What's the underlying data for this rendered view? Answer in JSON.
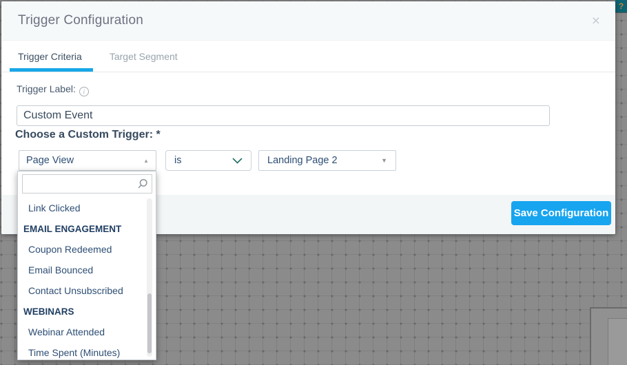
{
  "window": {
    "help_badge": "?"
  },
  "modal": {
    "title": "Trigger Configuration",
    "close": "×",
    "tabs": [
      {
        "label": "Trigger Criteria"
      },
      {
        "label": "Target Segment"
      }
    ],
    "fields": {
      "trigger_label": "Trigger Label:",
      "trigger_label_value": "Custom Event",
      "custom_trigger_label": "Choose a Custom Trigger: *"
    },
    "selects": {
      "trigger_type": "Page View",
      "operator": "is",
      "target": "Landing Page 2",
      "caret_up": "▲",
      "caret_down": "▼"
    },
    "dropdown": {
      "search_value": "",
      "search_placeholder": "",
      "items": [
        {
          "label": "Link Clicked",
          "type": "item"
        },
        {
          "label": "EMAIL ENGAGEMENT",
          "type": "header"
        },
        {
          "label": "Coupon Redeemed",
          "type": "item"
        },
        {
          "label": "Email Bounced",
          "type": "item"
        },
        {
          "label": "Contact Unsubscribed",
          "type": "item"
        },
        {
          "label": "WEBINARS",
          "type": "header"
        },
        {
          "label": "Webinar Attended",
          "type": "item"
        },
        {
          "label": "Time Spent (Minutes)",
          "type": "item"
        }
      ]
    },
    "footer": {
      "save_label": "Save Configuration"
    }
  },
  "icons": {
    "info": "i"
  },
  "colors": {
    "accent_blue": "#18a7e8",
    "button_blue": "#17a5ef",
    "navy_text": "#2d4e74",
    "chevron_teal": "#1e6e62",
    "canvas_gray": "#8b8b8b",
    "help_teal": "#0b6573"
  }
}
